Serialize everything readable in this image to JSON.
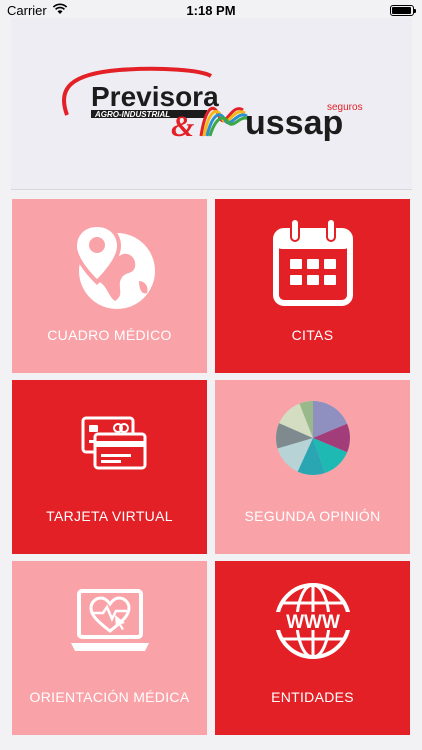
{
  "status_bar": {
    "carrier": "Carrier",
    "time": "1:18 PM"
  },
  "logo": {
    "brand_left": "Previsora",
    "brand_left_sub": "AGRO-INDUSTRIAL",
    "ampersand": "&",
    "brand_right": "ussap",
    "brand_right_tag": "seguros"
  },
  "tiles": [
    {
      "label": "CUADRO MÉDICO",
      "icon": "globe-location-icon",
      "style": "light"
    },
    {
      "label": "CITAS",
      "icon": "calendar-icon",
      "style": "dark"
    },
    {
      "label": "TARJETA VIRTUAL",
      "icon": "cards-icon",
      "style": "dark"
    },
    {
      "label": "SEGUNDA OPINIÓN",
      "icon": "color-circle-icon",
      "style": "light"
    },
    {
      "label": "ORIENTACIÓN MÉDICA",
      "icon": "laptop-heart-icon",
      "style": "light"
    },
    {
      "label": "ENTIDADES",
      "icon": "www-globe-icon",
      "style": "dark"
    }
  ],
  "colors": {
    "tile_light": "#f9a2a8",
    "tile_dark": "#e32026",
    "brand_red": "#e32026"
  }
}
